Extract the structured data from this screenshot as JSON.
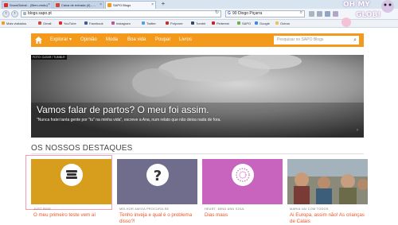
{
  "browser": {
    "tabs": [
      {
        "label": "SnowGlobal... (Bem-vindo)",
        "color": "#e02a2a"
      },
      {
        "label": "Caixa de entrada (4) - ...",
        "color": "#d44638"
      },
      {
        "label": "SAPO Blogs",
        "color": "#f39a1c"
      }
    ],
    "new_tab": "+",
    "address": "blogs.sapo.pt",
    "search_value": "90 Diogo Piçarra",
    "bookmarks": [
      "Mais visitados",
      "Gmail",
      "YouTube",
      "Facebook",
      "Instagram",
      "Twitter",
      "Polyvore",
      "Tumblr",
      "Pinterest",
      "SAPO",
      "Google",
      "Outros"
    ],
    "sticker": {
      "line1": "OH MY",
      "line2": "GLOB!"
    }
  },
  "site_nav": {
    "items": [
      "Explorar ▾",
      "Opinião",
      "Moda",
      "Boa vida",
      "Poupar",
      "Livros"
    ],
    "search_placeholder": "Pesquisar no SAPO Blogs"
  },
  "hero": {
    "tag": "FOTO: CLEAR / TUMBLR",
    "title": "Vamos falar de partos? O meu foi assim.",
    "description": "\"Nunca fratei tanta gente por \"tu\" na minha vida\", escreve a Ana, num relato que não deixa nada de fora.",
    "next": "›"
  },
  "section_title": "OS NOSSOS DESTAQUES",
  "cards": [
    {
      "category": "JUST RIDE",
      "title": "O meu primeiro teste vem aí",
      "icon": "books-icon",
      "bg": "#d79d1c"
    },
    {
      "category": "MELHOR AMIGA PROCURA-SE",
      "title": "Tenho inveja e qual é o problema disso?!",
      "icon": "question-icon",
      "bg": "#6f6c8c"
    },
    {
      "category": "HEART, MIND AND SOUL",
      "title": "Dias maus",
      "icon": "flower-icon",
      "bg": "#c863be"
    },
    {
      "category": "MARIA VAI COM TODOS",
      "title": "Ai Europa, assim não! As crianças de Calais",
      "icon": "photo",
      "bg": "#8a8a7a"
    }
  ]
}
